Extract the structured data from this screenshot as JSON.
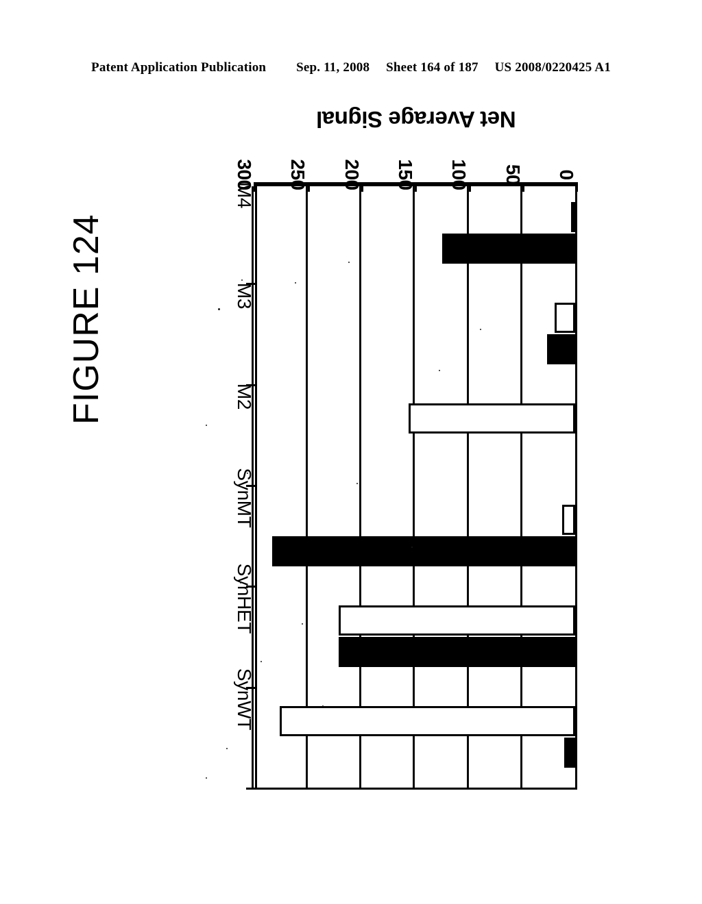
{
  "header": {
    "publication": "Patent Application Publication",
    "date": "Sep. 11, 2008",
    "sheet": "Sheet 164 of 187",
    "doc_number": "US 2008/0220425 A1"
  },
  "figure": {
    "title": "FIGURE 124"
  },
  "chart_data": {
    "type": "bar",
    "orientation": "horizontal",
    "title": "FIGURE 124",
    "xlabel": "",
    "ylabel": "Net Average Signal",
    "categories": [
      "SynWT",
      "SynHET",
      "SynMT",
      "M2",
      "M3",
      "M4"
    ],
    "series": [
      {
        "name": "series-white",
        "fill": "#ffffff",
        "values": [
          275,
          220,
          12,
          155,
          19,
          2
        ]
      },
      {
        "name": "series-black",
        "fill": "#000000",
        "values": [
          10,
          220,
          282,
          0,
          26,
          124
        ]
      }
    ],
    "value_axis": {
      "label": "Net Average Signal",
      "ticks": [
        0,
        50,
        100,
        150,
        200,
        250,
        300
      ],
      "tick_labels": [
        "0",
        "50",
        "100",
        "150",
        "200",
        "250",
        "300"
      ],
      "range": [
        0,
        300
      ],
      "direction": "right-to-left"
    },
    "grid": true,
    "legend": null
  },
  "axis_ticks": [
    {
      "label": "300",
      "value": 300
    },
    {
      "label": "250",
      "value": 250
    },
    {
      "label": "200",
      "value": 200
    },
    {
      "label": "150",
      "value": 150
    },
    {
      "label": "100",
      "value": 100
    },
    {
      "label": "50",
      "value": 50
    },
    {
      "label": "0",
      "value": 0
    }
  ],
  "axis_title": "Net Average Signal",
  "categories": [
    {
      "label": "SynWT"
    },
    {
      "label": "SynHET"
    },
    {
      "label": "SynMT"
    },
    {
      "label": "M2"
    },
    {
      "label": "M3"
    },
    {
      "label": "M4"
    }
  ]
}
